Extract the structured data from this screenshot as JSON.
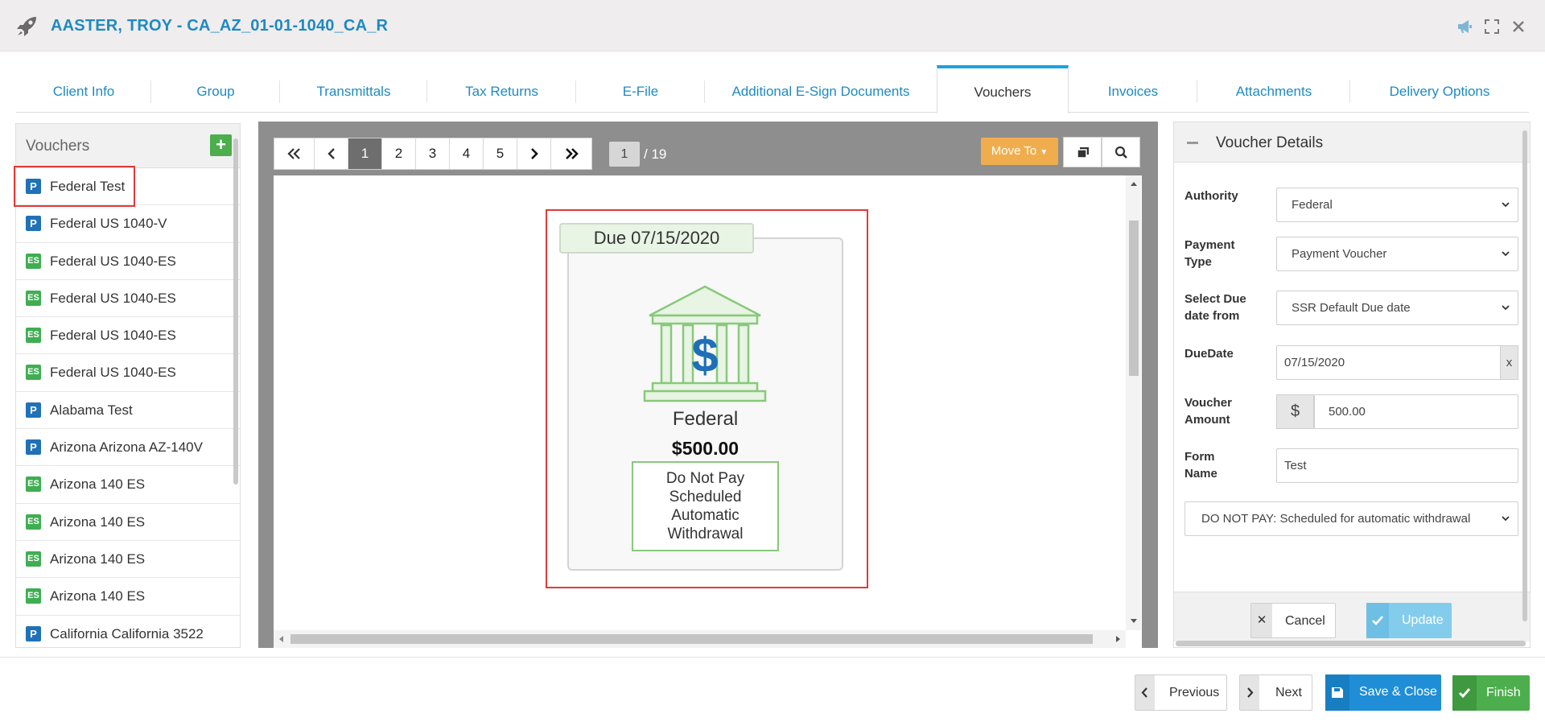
{
  "header": {
    "title": "AASTER, TROY - CA_AZ_01-01-1040_CA_R",
    "icons": [
      "rocket-icon",
      "megaphone-icon",
      "expand-icon",
      "close-icon"
    ]
  },
  "tabs": [
    {
      "label": "Client Info"
    },
    {
      "label": "Group"
    },
    {
      "label": "Transmittals"
    },
    {
      "label": "Tax Returns"
    },
    {
      "label": "E-File"
    },
    {
      "label": "Additional E-Sign Documents"
    },
    {
      "label": "Vouchers",
      "active": true
    },
    {
      "label": "Invoices"
    },
    {
      "label": "Attachments"
    },
    {
      "label": "Delivery Options"
    }
  ],
  "vouchers_panel": {
    "title": "Vouchers",
    "add_label": "+",
    "items": [
      {
        "badge": "P",
        "label": "Federal Test"
      },
      {
        "badge": "P",
        "label": "Federal US 1040-V"
      },
      {
        "badge": "ES",
        "label": "Federal US 1040-ES"
      },
      {
        "badge": "ES",
        "label": "Federal US 1040-ES"
      },
      {
        "badge": "ES",
        "label": "Federal US 1040-ES"
      },
      {
        "badge": "ES",
        "label": "Federal US 1040-ES"
      },
      {
        "badge": "P",
        "label": "Alabama Test"
      },
      {
        "badge": "P",
        "label": "Arizona Arizona AZ-140V"
      },
      {
        "badge": "ES",
        "label": "Arizona 140 ES"
      },
      {
        "badge": "ES",
        "label": "Arizona 140 ES"
      },
      {
        "badge": "ES",
        "label": "Arizona 140 ES"
      },
      {
        "badge": "ES",
        "label": "Arizona 140 ES"
      },
      {
        "badge": "P",
        "label": "California California 3522"
      }
    ]
  },
  "viewer": {
    "pages": [
      "1",
      "2",
      "3",
      "4",
      "5"
    ],
    "current_page": "1",
    "total_pages": "/ 19",
    "move_to_label": "Move To",
    "voucher_card": {
      "due": "Due 07/15/2020",
      "authority": "Federal",
      "amount": "$500.00",
      "note_lines": [
        "Do Not Pay",
        "Scheduled",
        "Automatic",
        "Withdrawal"
      ]
    }
  },
  "details": {
    "title": "Voucher Details",
    "authority_label": "Authority",
    "authority_value": "Federal",
    "payment_type_label": [
      "Payment",
      "Type"
    ],
    "payment_type_value": "Payment Voucher",
    "due_from_label": [
      "Select Due",
      "date from"
    ],
    "due_from_value": "SSR Default Due date",
    "due_date_label": "DueDate",
    "due_date_value": "07/15/2020",
    "clear_label": "x",
    "amount_label": [
      "Voucher",
      "Amount"
    ],
    "currency_symbol": "$",
    "amount_value": "500.00",
    "form_name_label": [
      "Form",
      "Name"
    ],
    "form_name_value": "Test",
    "instruction_value": "DO NOT PAY: Scheduled for automatic withdrawal",
    "cancel_label": "Cancel",
    "update_label": "Update"
  },
  "footer": {
    "previous_label": "Previous",
    "next_label": "Next",
    "save_close_label": "Save & Close",
    "finish_label": "Finish"
  },
  "colors": {
    "brand_blue": "#1f8ac0",
    "tab_active_border": "#1aa3e0",
    "highlight_red": "#e03a3a",
    "add_green": "#4cae4c",
    "move_to_orange": "#f0ad4e",
    "save_blue": "#1f8ed6",
    "finish_green": "#4cae4c"
  }
}
